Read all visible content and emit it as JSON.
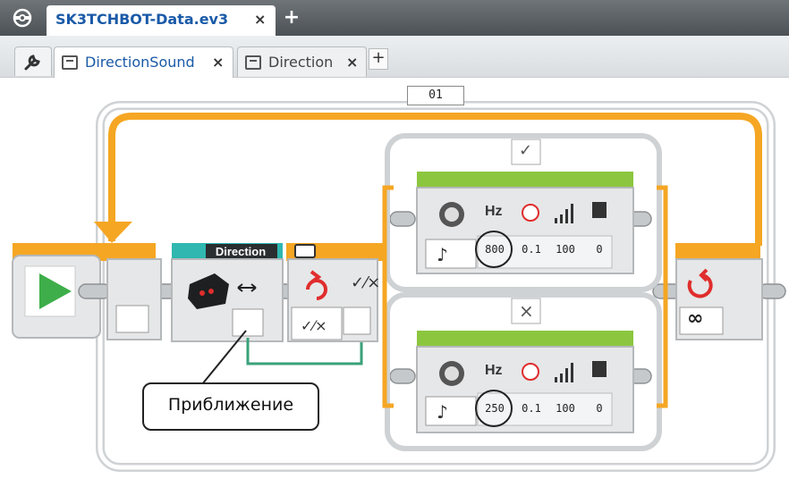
{
  "project_tabs": [
    {
      "label": "SK3TCHBOT-Data.ev3",
      "close": "×"
    }
  ],
  "add_project": "+",
  "program_tabs": [
    {
      "label": "DirectionSound",
      "close": "×",
      "active": true
    },
    {
      "label": "Direction",
      "close": "×",
      "active": false
    }
  ],
  "add_program": "+",
  "loop": {
    "name": "01",
    "mode_icon": "infinity-icon"
  },
  "sensor_block": {
    "header": "Direction",
    "icon": "ir-sensor-icon"
  },
  "switch": {
    "true_case": "✓",
    "false_case": "×",
    "mode_icon": "logic-icon"
  },
  "sound_blocks": [
    {
      "unit": "Hz",
      "frequency": "800",
      "duration": "0.1",
      "volume": "100",
      "play_type": "0"
    },
    {
      "unit": "Hz",
      "frequency": "250",
      "duration": "0.1",
      "volume": "100",
      "play_type": "0"
    }
  ],
  "callout": "Приближение",
  "colors": {
    "accent_orange": "#f5a623",
    "sensor_teal": "#2fb7b0",
    "sound_green": "#8cc63f",
    "wire_green": "#3aa17a",
    "start_green": "#3dae49",
    "switch_red": "#e02d2d"
  }
}
